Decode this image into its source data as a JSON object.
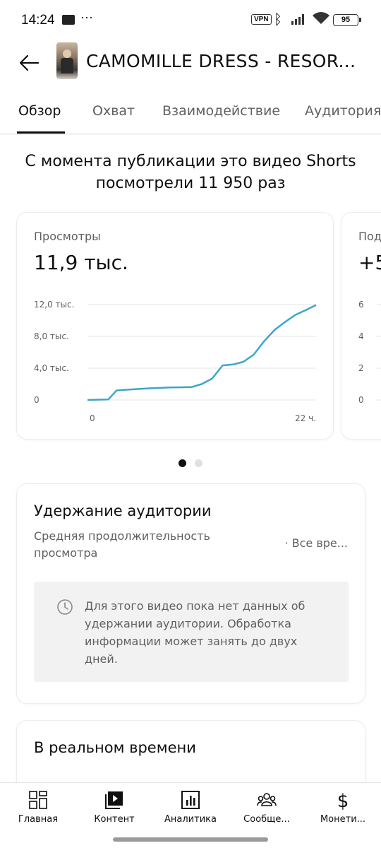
{
  "status_bar": {
    "time": "14:24",
    "dots": "···",
    "vpn": "VPN",
    "battery": "95"
  },
  "header": {
    "title": "CAMOMILLE DRESS - RESOR..."
  },
  "tabs": [
    {
      "label": "Обзор",
      "active": true
    },
    {
      "label": "Охват",
      "active": false
    },
    {
      "label": "Взаимодействие",
      "active": false
    },
    {
      "label": "Аудитория",
      "active": false
    }
  ],
  "summary": "С момента публикации это видео Shorts посмотрели 11 950 раз",
  "views_card": {
    "label": "Просмотры",
    "value": "11,9 тыс.",
    "chart_data": {
      "type": "line",
      "title": "",
      "xlabel": "",
      "ylabel": "",
      "x_ticks": [
        "0",
        "22 ч."
      ],
      "y_ticks": [
        "12,0 тыс.",
        "8,0 тыс.",
        "4,0 тыс.",
        "0"
      ],
      "ylim": [
        0,
        12000
      ],
      "xlim": [
        0,
        22
      ],
      "grid": true,
      "series": [
        {
          "color": "#3ea6c6",
          "x": [
            0,
            2,
            2.8,
            4,
            6,
            8,
            10,
            11,
            12,
            13,
            14,
            15,
            16,
            17,
            18,
            19,
            20,
            21,
            22
          ],
          "y": [
            0,
            60,
            1200,
            1320,
            1470,
            1570,
            1620,
            2000,
            2700,
            4350,
            4460,
            4800,
            5700,
            7400,
            8800,
            9800,
            10700,
            11300,
            11950
          ]
        }
      ],
      "line_color": "#3ea6c6"
    }
  },
  "subs_card": {
    "label": "Под",
    "value": "+5",
    "y_ticks": [
      "6",
      "4",
      "2",
      "0"
    ]
  },
  "pager": {
    "count": 2,
    "active": 0
  },
  "retention": {
    "title": "Удержание аудитории",
    "subtitle": "Средняя продолжительность просмотра",
    "period": "· Все вре...",
    "info": "Для этого видео пока нет данных об удержании аудитории. Обработка информации может занять до двух дней."
  },
  "realtime": {
    "title": "В реальном времени"
  },
  "bottom_nav": [
    {
      "label": "Главная",
      "icon": "dashboard-icon"
    },
    {
      "label": "Контент",
      "icon": "content-icon"
    },
    {
      "label": "Аналитика",
      "icon": "analytics-icon"
    },
    {
      "label": "Сообще...",
      "icon": "community-icon"
    },
    {
      "label": "Монети...",
      "icon": "monetization-icon"
    }
  ],
  "colors": {
    "accent": "#3ea6c6",
    "text": "#0f0f0f",
    "secondary_text": "#606060"
  }
}
